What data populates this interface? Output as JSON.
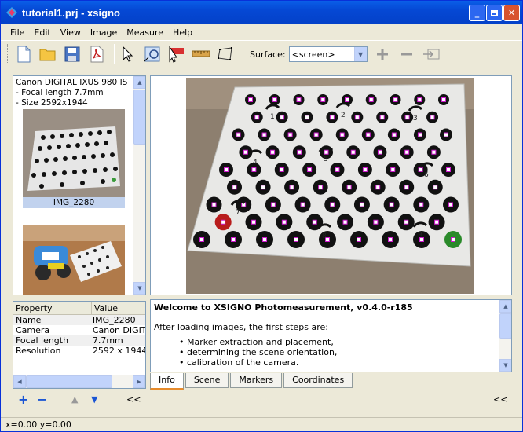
{
  "window": {
    "title": "tutorial1.prj - xsigno"
  },
  "menu": [
    "File",
    "Edit",
    "View",
    "Image",
    "Measure",
    "Help"
  ],
  "toolbar": {
    "surface_label": "Surface:",
    "surface_value": "<screen>"
  },
  "image_list": {
    "camera_lines": [
      "Canon DIGITAL IXUS 980 IS",
      "- Focal length 7.7mm",
      "- Size 2592x1944"
    ],
    "items": [
      {
        "caption": "IMG_2280",
        "selected": true
      },
      {
        "caption": "",
        "selected": false
      }
    ]
  },
  "properties": {
    "headers": [
      "Property",
      "Value"
    ],
    "rows": [
      [
        "Name",
        "IMG_2280"
      ],
      [
        "Camera",
        "Canon DIGITA"
      ],
      [
        "Focal length",
        "7.7mm"
      ],
      [
        "Resolution",
        "2592 x 1944"
      ]
    ]
  },
  "viewer": {
    "marker_labels": [
      "1",
      "2",
      "3",
      "4",
      "5",
      "6",
      "7",
      "8",
      "9"
    ]
  },
  "info": {
    "title": "Welcome to XSIGNO Photomeasurement, v0.4.0-r185",
    "intro": "After loading images, the first steps are:",
    "bullets": [
      "Marker extraction and placement,",
      "determining the scene orientation,",
      "calibration of the camera."
    ]
  },
  "tabs": [
    "Info",
    "Scene",
    "Markers",
    "Coordinates"
  ],
  "controls": {
    "add": "+",
    "remove": "−",
    "collapse_left": "<<",
    "collapse_right": "<<"
  },
  "status": "x=0.00 y=0.00",
  "colors": {
    "title_bar": "#0548d4",
    "selection": "#c1d2ee",
    "tab_accent": "#e68b2c"
  }
}
